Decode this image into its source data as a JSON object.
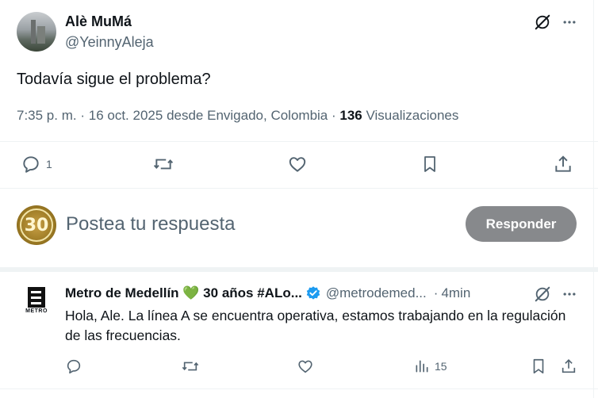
{
  "tweet": {
    "author_name": "Alè MuMá",
    "author_handle": "@YeinnyAleja",
    "text": "Todavía sigue el problema?",
    "time": "7:35 p. m.",
    "dot1": "·",
    "date": "16 oct. 2025",
    "location": "desde Envigado, Colombia",
    "dot2": "·",
    "views_count": "136",
    "views_label": "Visualizaciones",
    "reply_count": "1"
  },
  "composer": {
    "avatar_text": "30",
    "placeholder": "Postea tu respuesta",
    "button_label": "Responder"
  },
  "reply": {
    "author_name": "Metro de Medellín 💚 30 años #ALo...",
    "author_handle": "@metrodemed...",
    "dot": "·",
    "time": "4min",
    "text": "Hola, Ale. La línea A se encuentra operativa, estamos trabajando en la regulación de las frecuencias.",
    "logo_text": "METRO",
    "views_count": "15"
  },
  "colors": {
    "text": "#0f1419",
    "muted": "#536471",
    "divider": "#eff3f4",
    "verified": "#1d9bf0",
    "button_bg": "#87898c",
    "heart_green": "#78b159"
  }
}
